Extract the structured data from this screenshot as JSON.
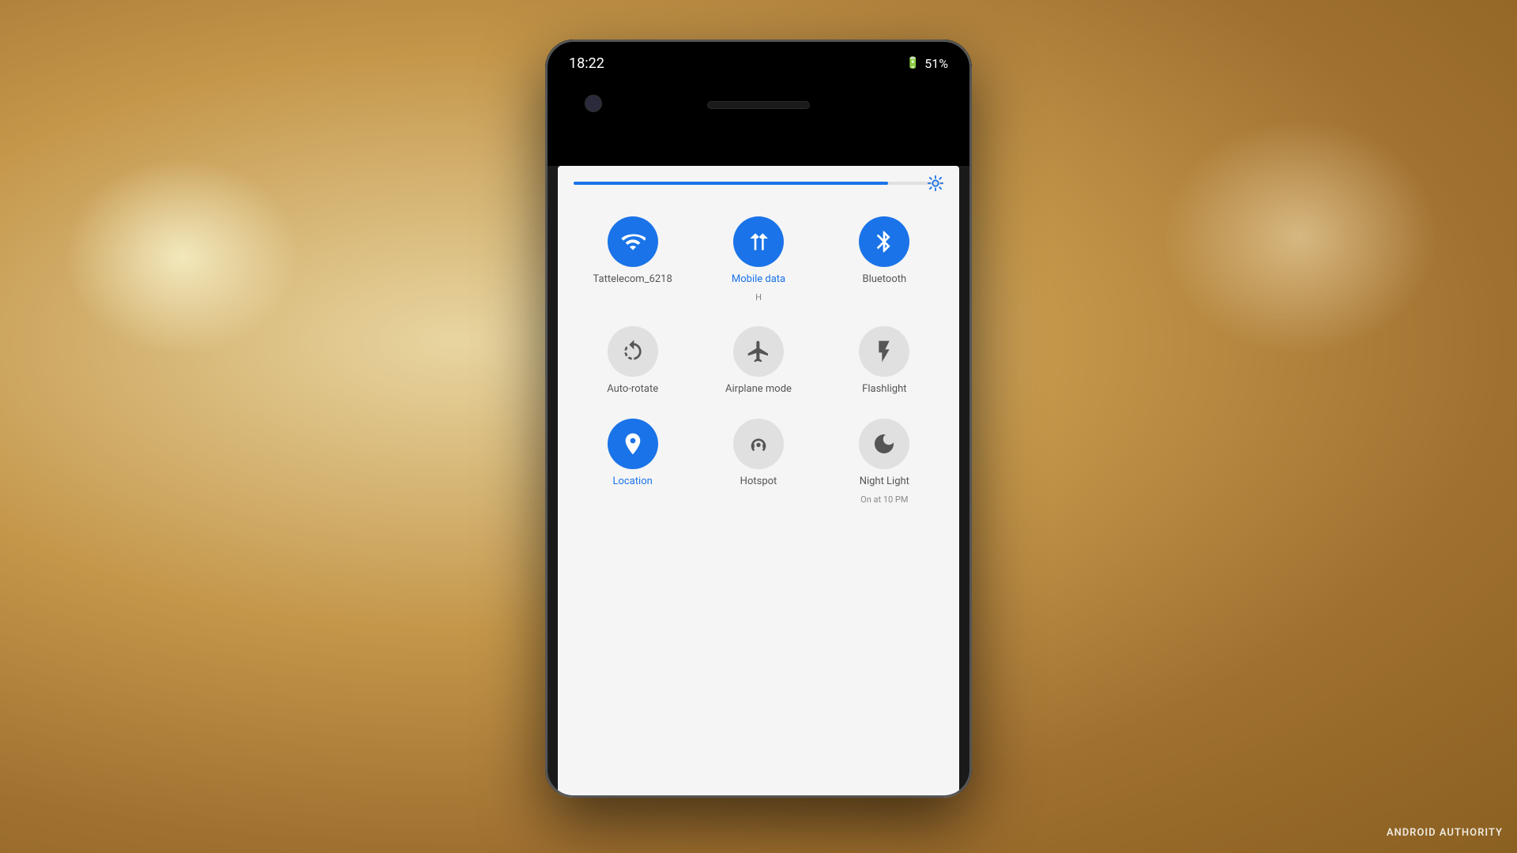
{
  "background": {
    "description": "Blurred warm yellow/brown bokeh background"
  },
  "watermark": {
    "text": "ANDROID AUTHORITY"
  },
  "phone": {
    "status_bar": {
      "time": "18:22",
      "battery_percent": "51%",
      "battery_icon": "🔋"
    },
    "brightness_slider": {
      "value": 85,
      "icon": "☀"
    },
    "tiles": [
      {
        "id": "wifi",
        "label": "Tattelecom_6218",
        "sublabel": "",
        "active": true,
        "icon": "wifi"
      },
      {
        "id": "mobile-data",
        "label": "Mobile data",
        "sublabel": "H",
        "active": true,
        "icon": "mobile-data"
      },
      {
        "id": "bluetooth",
        "label": "Bluetooth",
        "sublabel": "",
        "active": true,
        "icon": "bluetooth"
      },
      {
        "id": "auto-rotate",
        "label": "Auto-rotate",
        "sublabel": "",
        "active": false,
        "icon": "auto-rotate"
      },
      {
        "id": "airplane-mode",
        "label": "Airplane mode",
        "sublabel": "",
        "active": false,
        "icon": "airplane"
      },
      {
        "id": "flashlight",
        "label": "Flashlight",
        "sublabel": "",
        "active": false,
        "icon": "flashlight"
      },
      {
        "id": "location",
        "label": "Location",
        "sublabel": "",
        "active": true,
        "icon": "location"
      },
      {
        "id": "hotspot",
        "label": "Hotspot",
        "sublabel": "",
        "active": false,
        "icon": "hotspot"
      },
      {
        "id": "night-light",
        "label": "Night Light",
        "sublabel": "On at 10 PM",
        "active": false,
        "icon": "night-light"
      }
    ]
  }
}
